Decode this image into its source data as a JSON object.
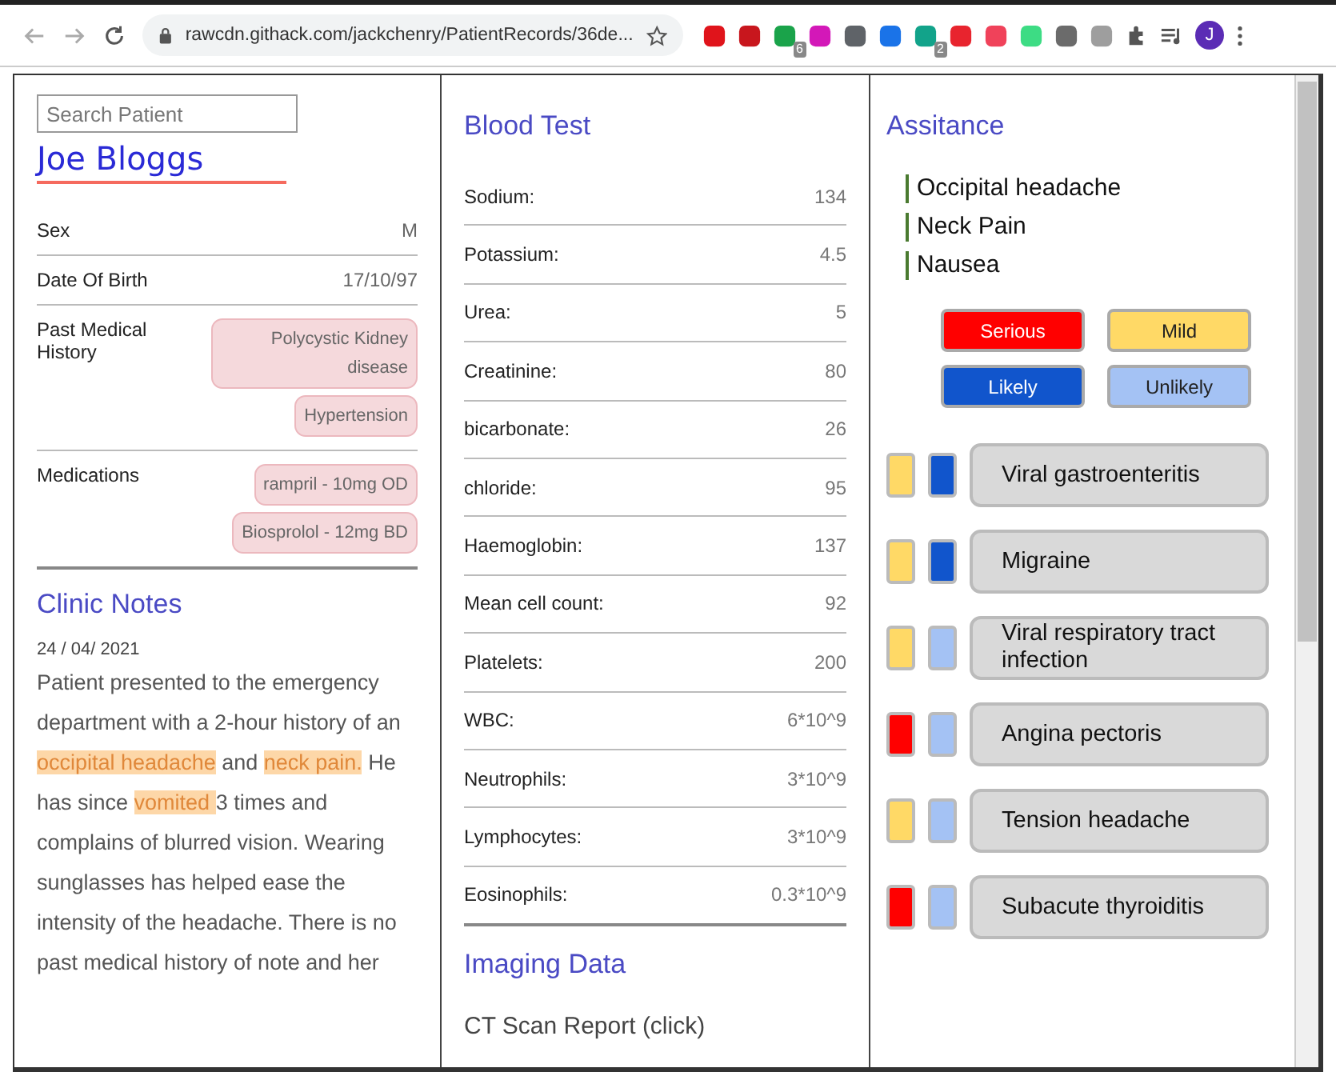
{
  "browser": {
    "url": "rawcdn.githack.com/jackchenry/PatientRecords/36de...",
    "extensions": [
      {
        "color": "#e0141b"
      },
      {
        "color": "#c8161d"
      },
      {
        "color": "#1aa34a",
        "badge": "6"
      },
      {
        "color": "#d318b8"
      },
      {
        "color": "#5f6368"
      },
      {
        "color": "#1a73e8"
      },
      {
        "color": "#12a38a",
        "badge": "2"
      },
      {
        "color": "#e8242e"
      },
      {
        "color": "#f0425a"
      },
      {
        "color": "#3ddc84"
      },
      {
        "color": "#6b6b6b"
      },
      {
        "color": "#9e9e9e"
      }
    ],
    "profile_initial": "J"
  },
  "patient": {
    "search": {
      "placeholder": "Search Patient"
    },
    "name": "Joe Bloggs",
    "fields": [
      {
        "label": "Sex",
        "values": [
          "M"
        ],
        "kind": "text"
      },
      {
        "label": "Date Of Birth",
        "values": [
          "17/10/97"
        ],
        "kind": "text"
      },
      {
        "label": "Past Medical History",
        "values": [
          "Polycystic Kidney disease",
          "Hypertension"
        ],
        "kind": "tags"
      },
      {
        "label": "Medications",
        "values": [
          "rampril - 10mg OD",
          "Biosprolol - 12mg BD"
        ],
        "kind": "tags"
      }
    ]
  },
  "clinic_notes": {
    "title": "Clinic Notes",
    "date": "24 / 04/ 2021",
    "segments": [
      {
        "text": "Patient presented to the emergency department with a 2-hour history of an ",
        "highlight": false
      },
      {
        "text": "occipital headache",
        "highlight": true
      },
      {
        "text": " and ",
        "highlight": false
      },
      {
        "text": "neck pain.",
        "highlight": true
      },
      {
        "text": " He has since ",
        "highlight": false
      },
      {
        "text": "vomited ",
        "highlight": true
      },
      {
        "text": "3 times and complains of blurred vision. Wearing sunglasses has helped ease the intensity of the headache. There is no past medical history of note and her",
        "highlight": false
      }
    ]
  },
  "blood_test": {
    "title": "Blood Test",
    "rows": [
      {
        "name": "Sodium:",
        "value": "134"
      },
      {
        "name": "Potassium:",
        "value": "4.5"
      },
      {
        "name": "Urea:",
        "value": "5"
      },
      {
        "name": "Creatinine:",
        "value": "80"
      },
      {
        "name": "bicarbonate:",
        "value": "26"
      },
      {
        "name": "chloride:",
        "value": "95"
      },
      {
        "name": "Haemoglobin:",
        "value": "137"
      },
      {
        "name": "Mean cell count:",
        "value": "92"
      },
      {
        "name": "Platelets:",
        "value": "200"
      },
      {
        "name": "WBC:",
        "value": "6*10^9"
      },
      {
        "name": "Neutrophils:",
        "value": "3*10^9"
      },
      {
        "name": "Lymphocytes:",
        "value": "3*10^9"
      },
      {
        "name": "Eosinophils:",
        "value": "0.3*10^9"
      }
    ]
  },
  "imaging": {
    "title": "Imaging Data",
    "link": "CT Scan Report (click)"
  },
  "assistance": {
    "title": "Assitance",
    "symptoms": [
      "Occipital headache",
      "Neck Pain",
      "Nausea"
    ],
    "legend": [
      {
        "label": "Serious",
        "kind": "serious",
        "color": "#ff0000"
      },
      {
        "label": "Mild",
        "kind": "mild",
        "color": "#ffd966"
      },
      {
        "label": "Likely",
        "kind": "likely",
        "color": "#1155cc"
      },
      {
        "label": "Unlikely",
        "kind": "unlikely",
        "color": "#a4c2f4"
      }
    ],
    "conditions": [
      {
        "name": "Viral gastroenteritis",
        "serious": false,
        "likely": true
      },
      {
        "name": "Migraine",
        "serious": false,
        "likely": true
      },
      {
        "name": "Viral respiratory tract infection",
        "serious": false,
        "likely": false
      },
      {
        "name": "Angina pectoris",
        "serious": true,
        "likely": false
      },
      {
        "name": "Tension headache",
        "serious": false,
        "likely": false
      },
      {
        "name": "Subacute thyroiditis",
        "serious": true,
        "likely": false
      }
    ]
  }
}
